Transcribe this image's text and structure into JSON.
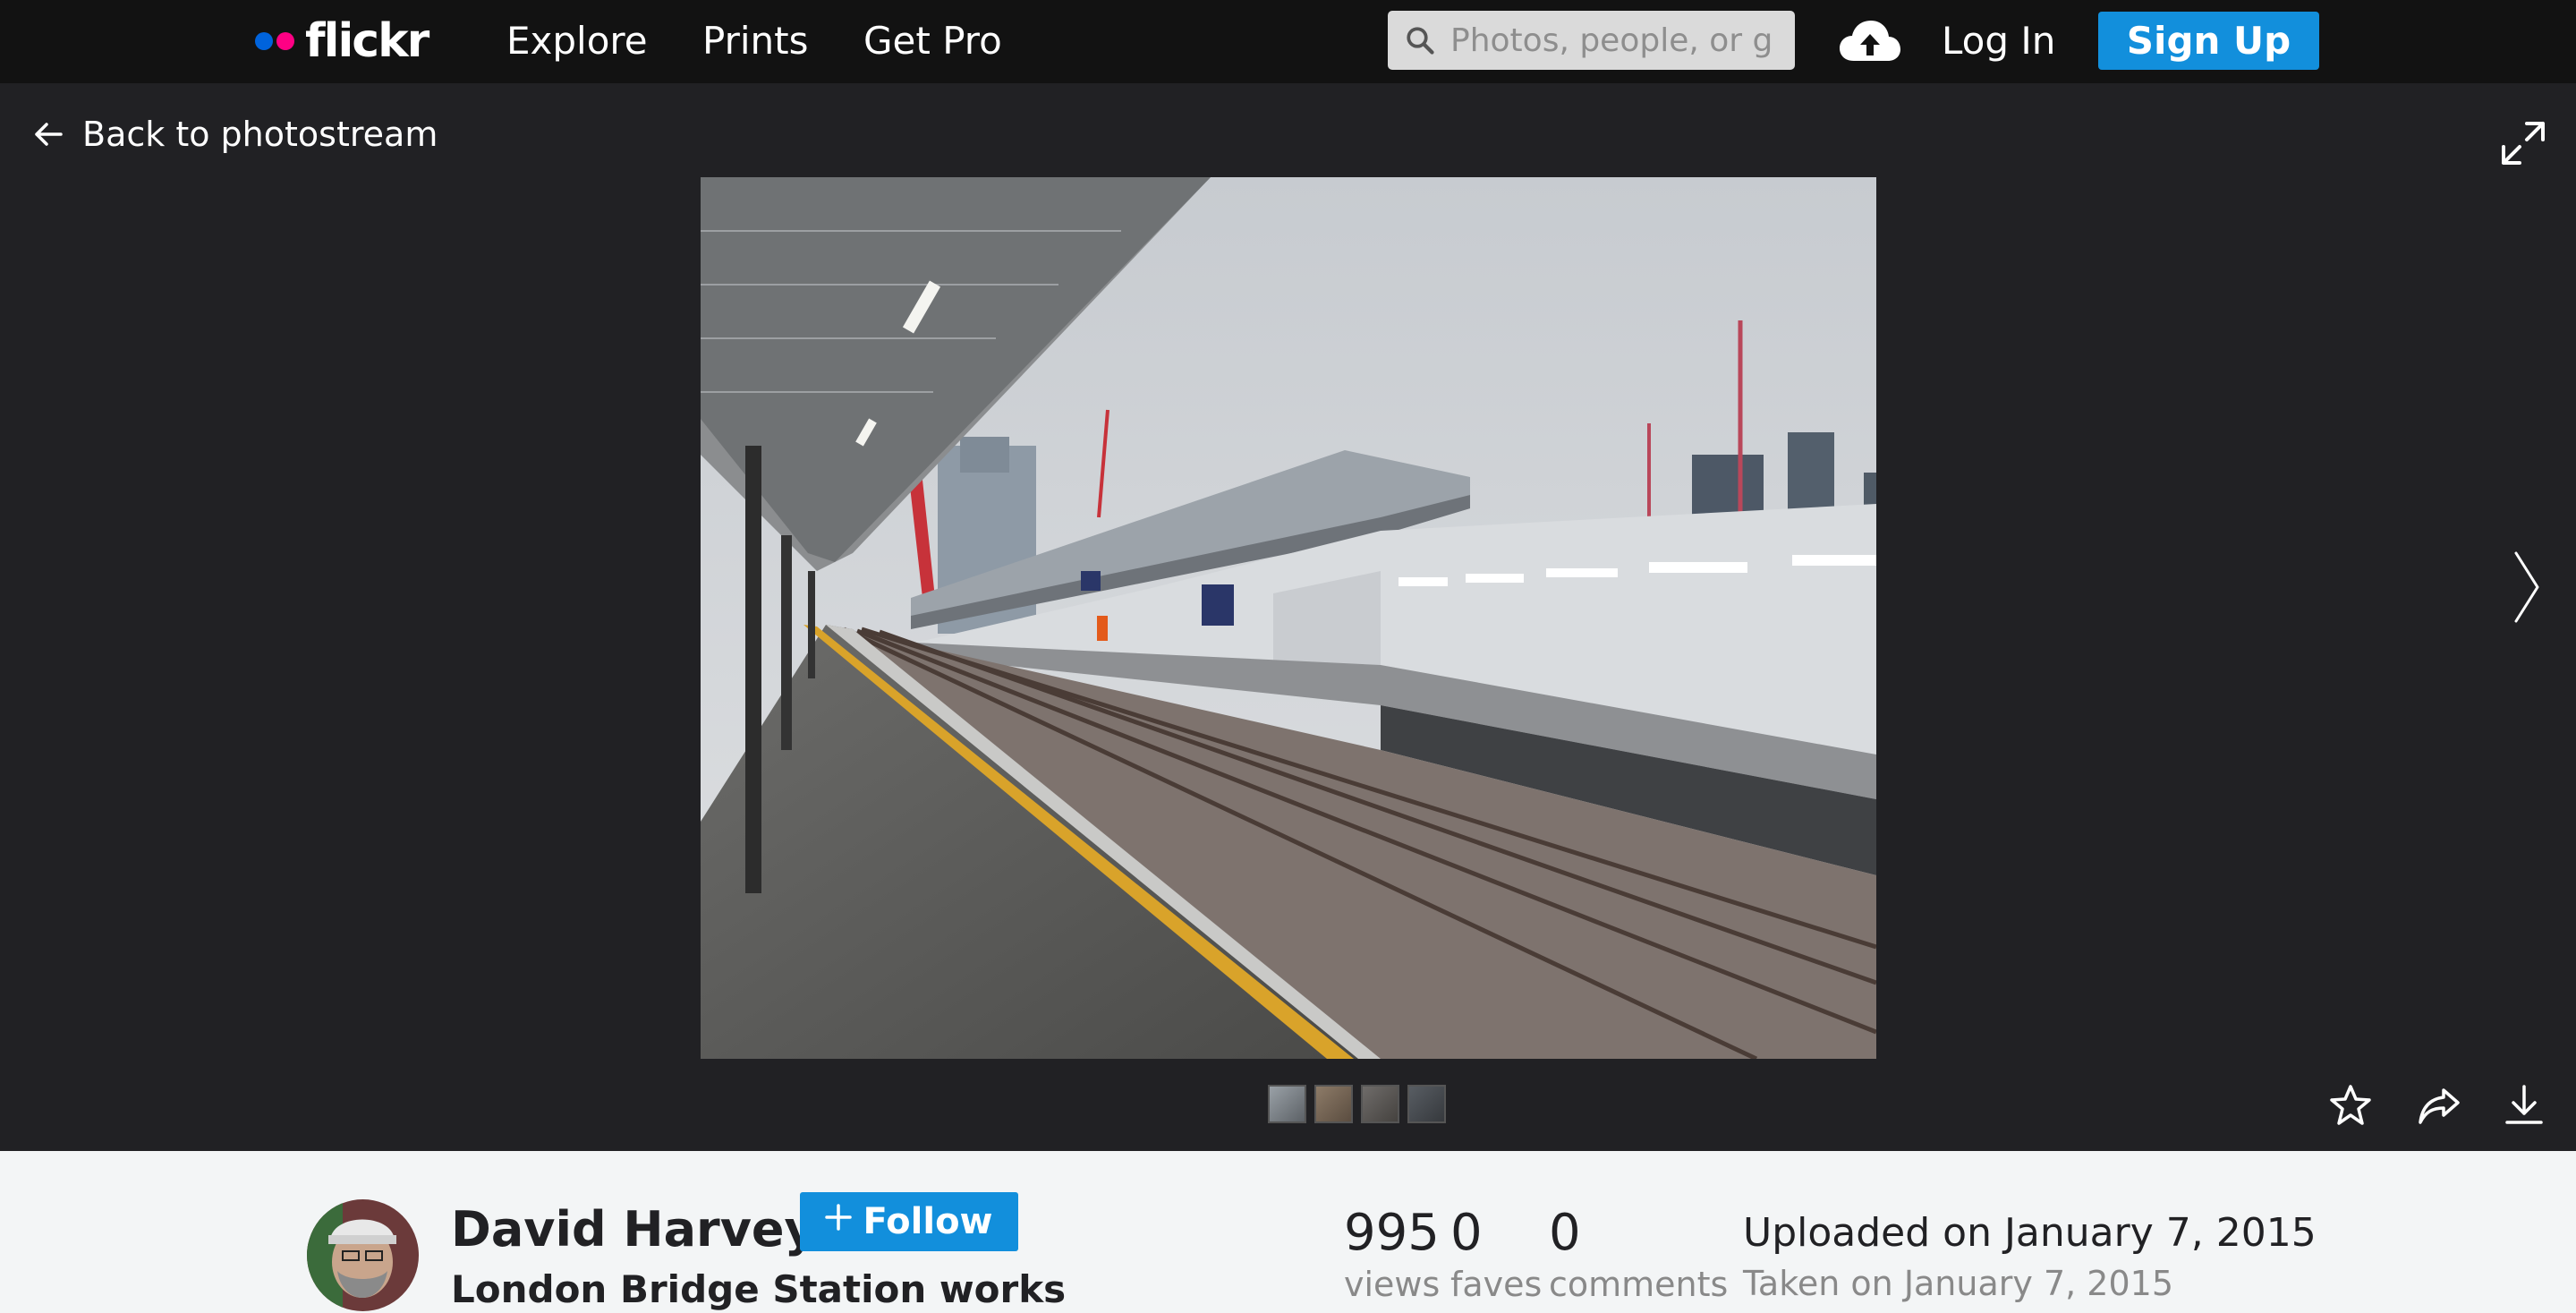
{
  "nav": {
    "logo": "flickr",
    "links": [
      "Explore",
      "Prints",
      "Get Pro"
    ],
    "search_placeholder": "Photos, people, or groups",
    "login": "Log In",
    "signup": "Sign Up"
  },
  "viewer": {
    "back_label": "Back to photostream",
    "thumbnail_count": 4
  },
  "photo_info": {
    "author": "David Harvey",
    "follow_label": "Follow",
    "title": "London Bridge Station works",
    "views": "995",
    "views_label": "views",
    "faves": "0",
    "faves_label": "faves",
    "comments": "0",
    "comments_label": "comments",
    "uploaded": "Uploaded on January 7, 2015",
    "taken": "Taken on January 7, 2015"
  },
  "colors": {
    "nav_bg": "#121212",
    "viewer_bg": "#212124",
    "accent_blue": "#128fdc",
    "logo_blue": "#0063dc",
    "logo_pink": "#ff0084",
    "info_bg": "#f3f5f6"
  },
  "icons": [
    "search-icon",
    "cloud-upload-icon",
    "back-arrow-icon",
    "expand-icon",
    "next-arrow-icon",
    "star-icon",
    "share-icon",
    "download-icon",
    "plus-icon"
  ]
}
